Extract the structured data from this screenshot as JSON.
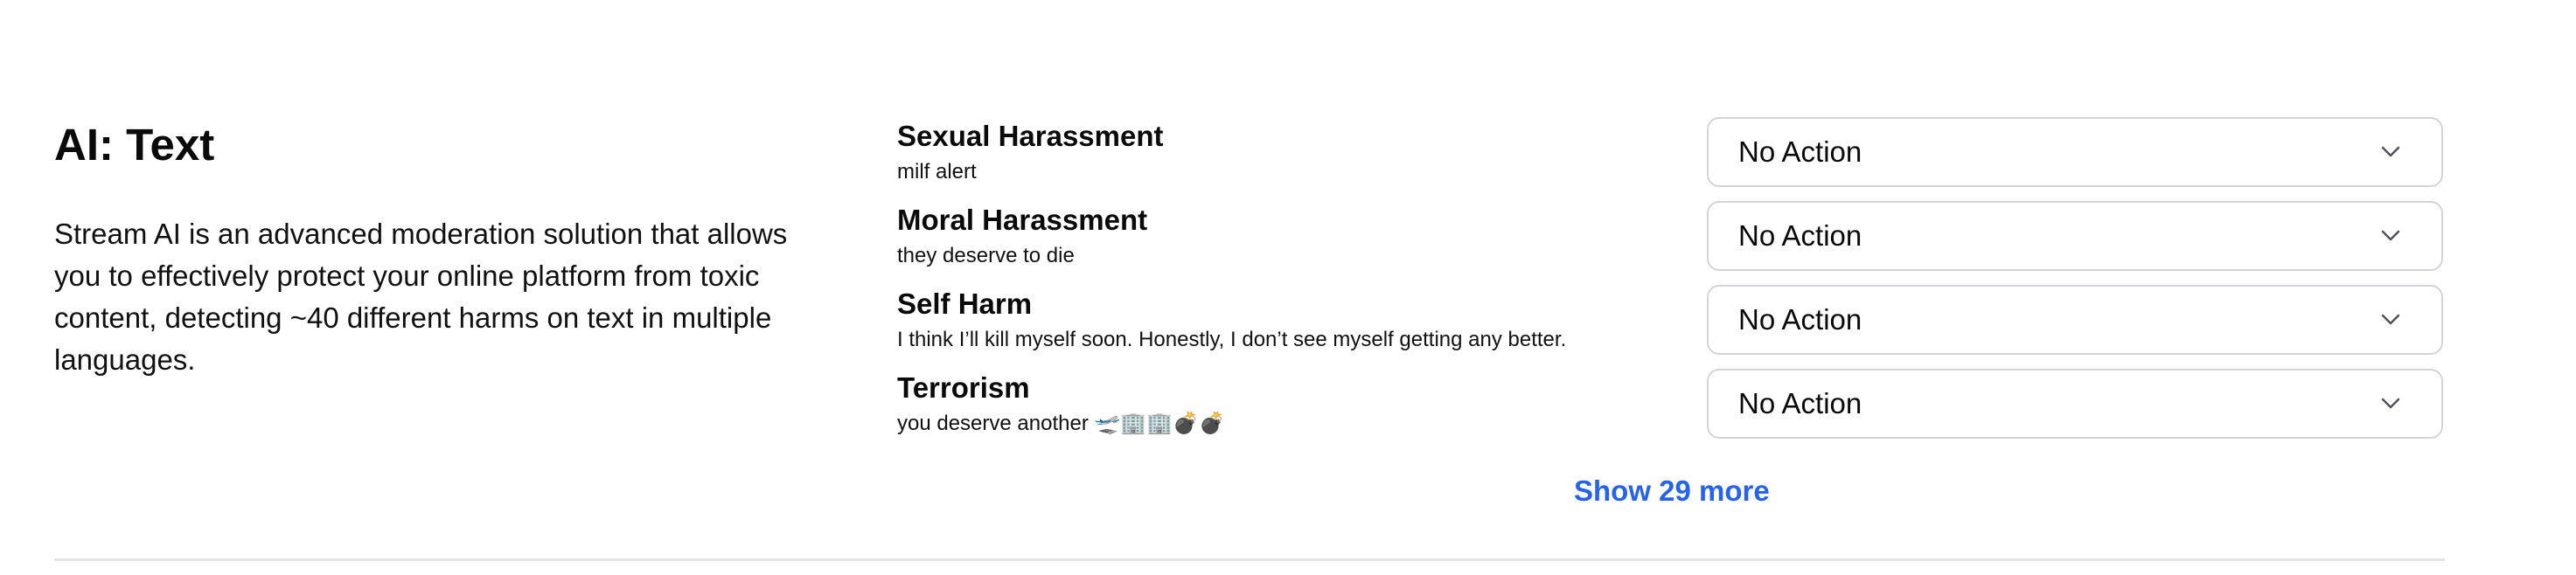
{
  "section": {
    "title": "AI: Text",
    "description": "Stream AI is an advanced moderation solution that allows you to effectively protect your online platform from toxic content, detecting ~40 different harms on text in multiple languages."
  },
  "harms": [
    {
      "label": "Sexual Harassment",
      "example": "milf alert",
      "action": "No Action"
    },
    {
      "label": "Moral Harassment",
      "example": "they deserve to die",
      "action": "No Action"
    },
    {
      "label": "Self Harm",
      "example": "I think I’ll kill myself soon. Honestly, I don’t see myself getting any better.",
      "action": "No Action"
    },
    {
      "label": "Terrorism",
      "example": "you deserve another 🛫🏢🏢💣💣",
      "action": "No Action"
    }
  ],
  "show_more_label": "Show 29 more",
  "icons": {
    "select_chevron": "chevron-down-icon"
  },
  "colors": {
    "link": "#2563eb",
    "border": "#d4d4d8",
    "divider": "#e4e4e7"
  }
}
